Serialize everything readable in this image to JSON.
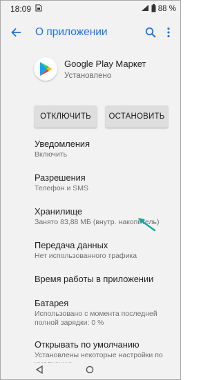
{
  "status_bar": {
    "time": "18:09",
    "battery_percent": "88 %"
  },
  "app_bar": {
    "title": "О приложении"
  },
  "app": {
    "name": "Google Play Маркет",
    "status": "Установлено"
  },
  "buttons": {
    "disable": "ОТКЛЮЧИТЬ",
    "stop": "ОСТАНОВИТЬ"
  },
  "items": [
    {
      "title": "Уведомления",
      "subtitle": "Включить"
    },
    {
      "title": "Разрешения",
      "subtitle": "Телефон и SMS"
    },
    {
      "title": "Хранилище",
      "subtitle": "Занято 83,88 МБ (внутр. накопитель)"
    },
    {
      "title": "Передача данных",
      "subtitle": "Нет использованного трафика"
    },
    {
      "title": "Время работы в приложении",
      "subtitle": ""
    },
    {
      "title": "Батарея",
      "subtitle": "Использовано с момента последней полной зарядки: 0 %"
    },
    {
      "title": "Открывать по умолчанию",
      "subtitle": "Установлены некоторые настройки по умолчанию"
    }
  ],
  "colors": {
    "accent": "#1a73e8",
    "arrow": "#1aa39b",
    "background": "#f2f2f2"
  },
  "icons": [
    "back-arrow-icon",
    "search-icon",
    "more-vert-icon",
    "google-play-icon",
    "sim-icon",
    "signal-icon",
    "battery-icon",
    "back-triangle-icon",
    "home-circle-icon"
  ]
}
